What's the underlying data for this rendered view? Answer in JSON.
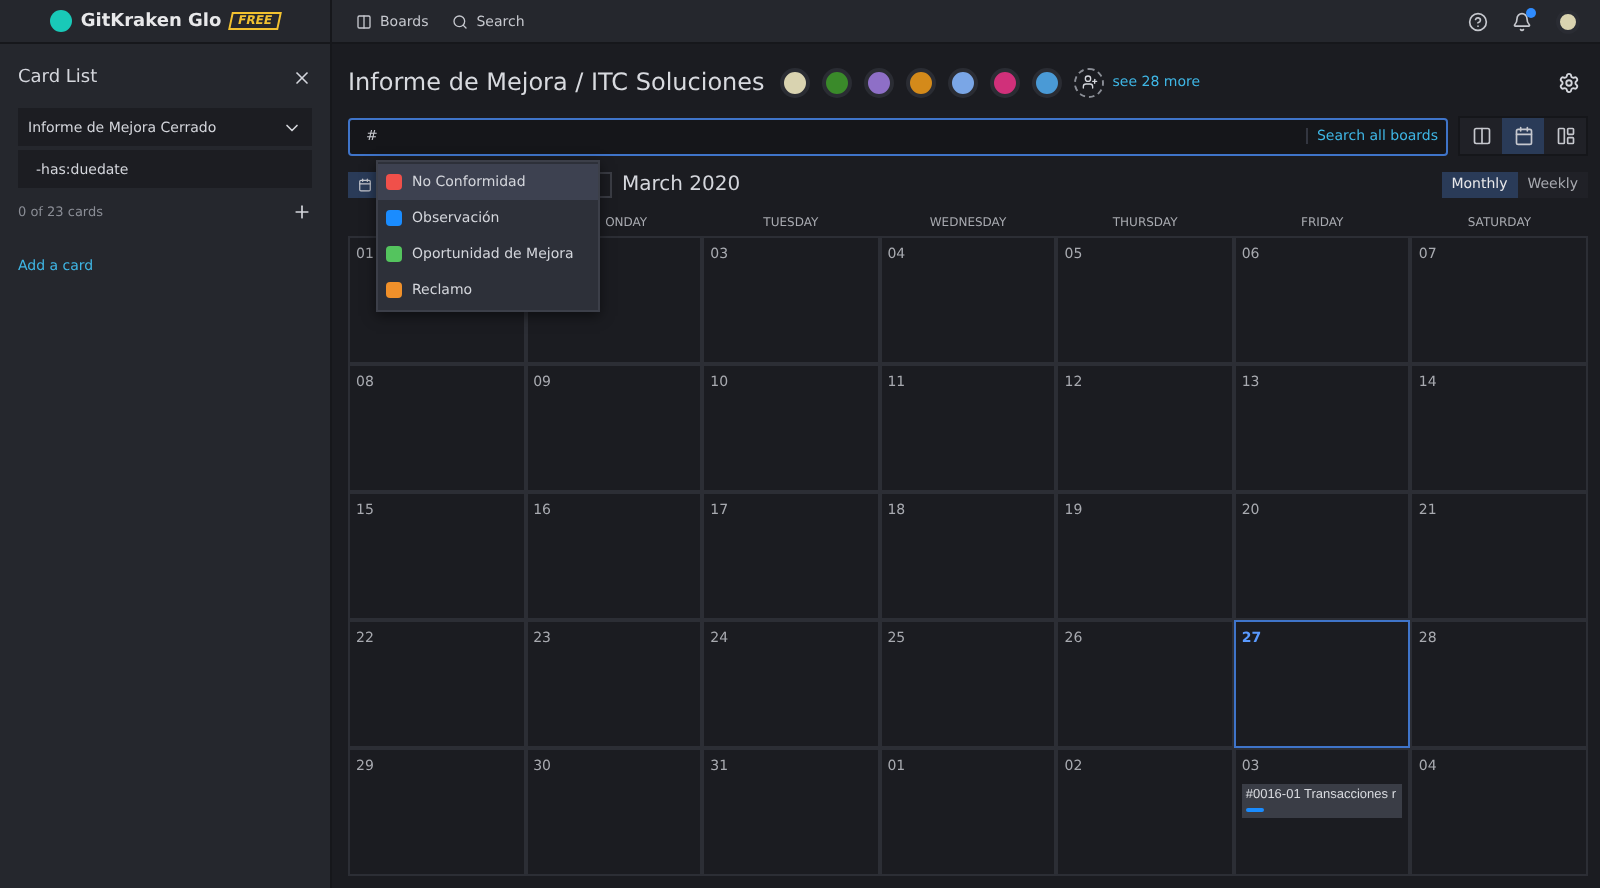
{
  "topbar": {
    "product": "GitKraken Glo",
    "plan": "FREE",
    "nav": [
      "Boards",
      "Search"
    ],
    "notifications": true
  },
  "sidebar": {
    "title": "Card List",
    "column": "Informe de Mejora Cerrado",
    "filter": "-has:duedate",
    "count": "0 of 23 cards",
    "add_link": "Add a card"
  },
  "board": {
    "title": "Informe de Mejora / ITC Soluciones",
    "members": [
      {
        "color": "#d9d3b0"
      },
      {
        "color": "#3a8a2a"
      },
      {
        "color": "#8e6fc7"
      },
      {
        "color": "#d48a1a"
      },
      {
        "color": "#7aa6e6"
      },
      {
        "color": "#d0307a"
      },
      {
        "color": "#4a9ad6"
      }
    ],
    "more": "see 28 more"
  },
  "search": {
    "value": "#",
    "scope_link": "Search all boards"
  },
  "views": [
    {
      "kind": "board",
      "selected": false
    },
    {
      "kind": "calendar",
      "selected": true
    },
    {
      "kind": "timeline",
      "selected": false
    }
  ],
  "label_menu": [
    {
      "name": "No Conformidad",
      "color": "#f0504a",
      "selected": true
    },
    {
      "name": "Observación",
      "color": "#1a8cff",
      "selected": false
    },
    {
      "name": "Oportunidad de Mejora",
      "color": "#54c45e",
      "selected": false
    },
    {
      "name": "Reclamo",
      "color": "#f0902a",
      "selected": false
    }
  ],
  "calendar": {
    "month": "March 2020",
    "modes": [
      {
        "label": "Monthly",
        "selected": true
      },
      {
        "label": "Weekly",
        "selected": false
      }
    ],
    "weekdays": [
      "ONDAY",
      "TUESDAY",
      "WEDNESDAY",
      "THURSDAY",
      "FRIDAY",
      "SATURDAY"
    ],
    "weeks": [
      [
        {
          "day": "01",
          "today": false
        },
        {
          "today": false
        },
        {
          "day": "03",
          "today": false
        },
        {
          "day": "04",
          "today": false
        },
        {
          "day": "05",
          "today": false
        },
        {
          "day": "06",
          "today": false
        },
        {
          "day": "07",
          "today": false
        }
      ],
      [
        {
          "day": "08",
          "today": false
        },
        {
          "day": "09",
          "today": false
        },
        {
          "day": "10",
          "today": false
        },
        {
          "day": "11",
          "today": false
        },
        {
          "day": "12",
          "today": false
        },
        {
          "day": "13",
          "today": false
        },
        {
          "day": "14",
          "today": false
        }
      ],
      [
        {
          "day": "15",
          "today": false
        },
        {
          "day": "16",
          "today": false
        },
        {
          "day": "17",
          "today": false
        },
        {
          "day": "18",
          "today": false
        },
        {
          "day": "19",
          "today": false
        },
        {
          "day": "20",
          "today": false
        },
        {
          "day": "21",
          "today": false
        }
      ],
      [
        {
          "day": "22",
          "today": false
        },
        {
          "day": "23",
          "today": false
        },
        {
          "day": "24",
          "today": false
        },
        {
          "day": "25",
          "today": false
        },
        {
          "day": "26",
          "today": false
        },
        {
          "day": "27",
          "today": true
        },
        {
          "day": "28",
          "today": false
        }
      ],
      [
        {
          "day": "29",
          "today": false
        },
        {
          "day": "30",
          "today": false
        },
        {
          "day": "31",
          "today": false
        },
        {
          "day": "01",
          "today": false
        },
        {
          "day": "02",
          "today": false
        },
        {
          "day": "03",
          "today": false,
          "cards": [
            {
              "title": "#0016-01 Transacciones r",
              "color": "#1a8cff"
            }
          ]
        },
        {
          "day": "04",
          "today": false
        }
      ]
    ]
  }
}
